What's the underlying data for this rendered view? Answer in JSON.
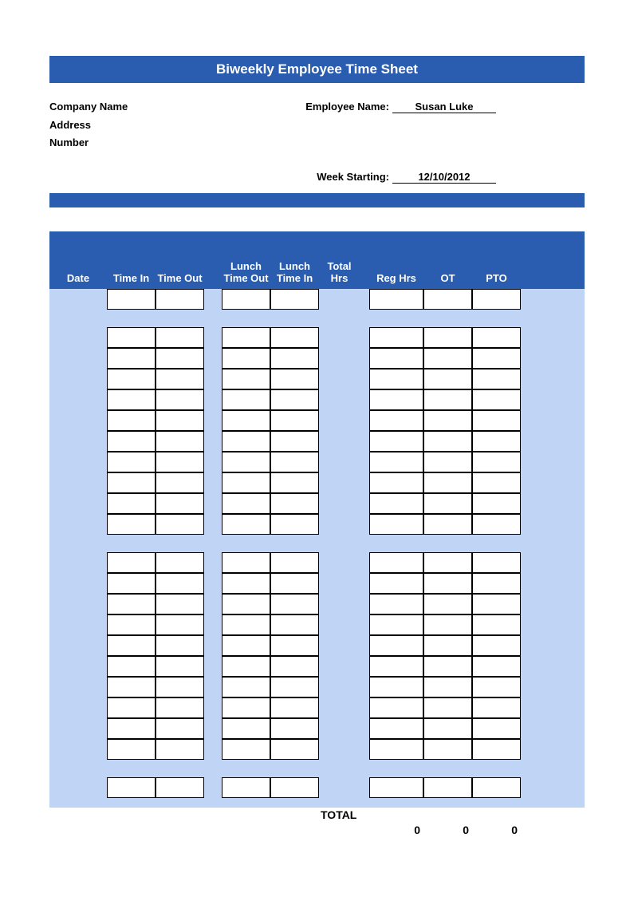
{
  "title": "Biweekly Employee Time Sheet",
  "info": {
    "company_label": "Company Name",
    "address_label": "Address",
    "number_label": "Number",
    "employee_label": "Employee Name:",
    "employee_value": "Susan Luke",
    "week_label": "Week Starting:",
    "week_value": "12/10/2012"
  },
  "columns": {
    "date": "Date",
    "time_in": "Time In",
    "time_out": "Time Out",
    "lunch_out": "Lunch Time Out",
    "lunch_in": "Lunch Time In",
    "total": "Total Hrs",
    "reg": "Reg Hrs",
    "ot": "OT",
    "pto": "PTO"
  },
  "totals": {
    "label": "TOTAL",
    "reg": "0",
    "ot": "0",
    "pto": "0"
  }
}
